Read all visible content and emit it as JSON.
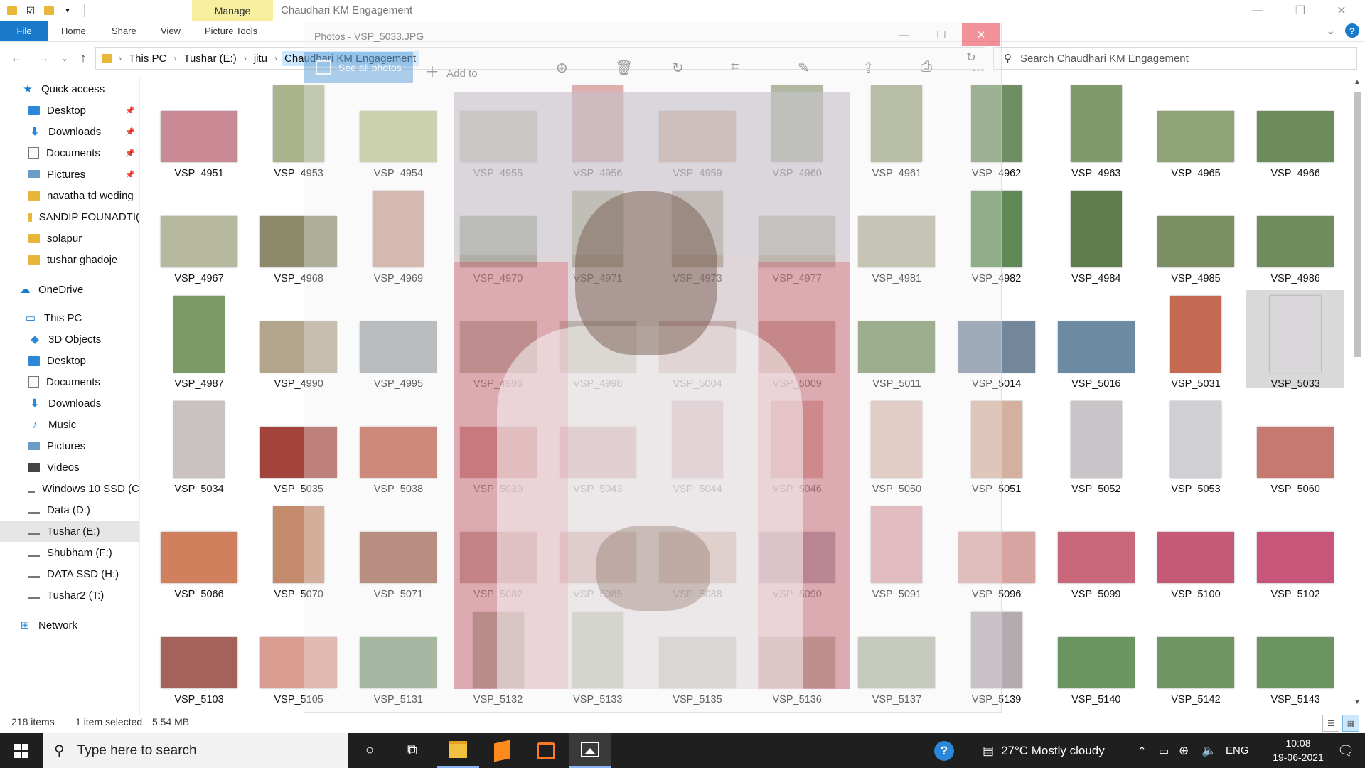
{
  "window": {
    "title": "Chaudhari KM Engagement",
    "manage_label": "Manage",
    "minimize_icon": "—",
    "restore_icon": "❐",
    "close_icon": "✕"
  },
  "ribbon": {
    "tabs": [
      "File",
      "Home",
      "Share",
      "View",
      "Picture Tools"
    ],
    "expand_icon": "⌄",
    "help_icon": "?"
  },
  "address": {
    "breadcrumbs": [
      "This PC",
      "Tushar (E:)",
      "jitu",
      "Chaudhari KM Engagement"
    ],
    "search_placeholder": "Search Chaudhari KM Engagement"
  },
  "nav": {
    "items": [
      {
        "label": "Quick access",
        "icon": "star-icon"
      },
      {
        "label": "Desktop",
        "icon": "desktop-folder-icon",
        "pinned": true
      },
      {
        "label": "Downloads",
        "icon": "downloads-icon",
        "pinned": true
      },
      {
        "label": "Documents",
        "icon": "documents-icon",
        "pinned": true
      },
      {
        "label": "Pictures",
        "icon": "pictures-icon",
        "pinned": true
      },
      {
        "label": "navatha td weding",
        "icon": "folder-icon"
      },
      {
        "label": "SANDIP FOUNADTI(",
        "icon": "folder-icon"
      },
      {
        "label": "solapur",
        "icon": "folder-icon"
      },
      {
        "label": "tushar ghadoje",
        "icon": "folder-icon"
      },
      {
        "label": "OneDrive",
        "icon": "cloud-icon"
      },
      {
        "label": "This PC",
        "icon": "computer-icon"
      },
      {
        "label": "3D Objects",
        "icon": "cube-icon"
      },
      {
        "label": "Desktop",
        "icon": "desktop-folder-icon"
      },
      {
        "label": "Documents",
        "icon": "documents-icon"
      },
      {
        "label": "Downloads",
        "icon": "downloads-icon"
      },
      {
        "label": "Music",
        "icon": "music-icon"
      },
      {
        "label": "Pictures",
        "icon": "pictures-icon"
      },
      {
        "label": "Videos",
        "icon": "videos-icon"
      },
      {
        "label": "Windows 10 SSD (C",
        "icon": "windows-drive-icon"
      },
      {
        "label": "Data (D:)",
        "icon": "drive-icon"
      },
      {
        "label": "Tushar (E:)",
        "icon": "drive-icon",
        "selected": true
      },
      {
        "label": "Shubham (F:)",
        "icon": "drive-icon"
      },
      {
        "label": "DATA SSD (H:)",
        "icon": "drive-icon"
      },
      {
        "label": "Tushar2 (T:)",
        "icon": "drive-icon"
      },
      {
        "label": "Network",
        "icon": "network-icon"
      }
    ]
  },
  "files": [
    {
      "name": "VSP_4951",
      "orient": "l",
      "color": "#c98a96"
    },
    {
      "name": "VSP_4953",
      "orient": "p",
      "color": "#a9b48c"
    },
    {
      "name": "VSP_4954",
      "orient": "l",
      "color": "#b9c08e"
    },
    {
      "name": "VSP_4955",
      "orient": "l",
      "color": "#b5bfa0"
    },
    {
      "name": "VSP_4956",
      "orient": "p",
      "color": "#cf8e8a"
    },
    {
      "name": "VSP_4959",
      "orient": "l",
      "color": "#c99c7e"
    },
    {
      "name": "VSP_4960",
      "orient": "p",
      "color": "#8e9a78"
    },
    {
      "name": "VSP_4961",
      "orient": "p",
      "color": "#9aa47e"
    },
    {
      "name": "VSP_4962",
      "orient": "p",
      "color": "#6f8f63"
    },
    {
      "name": "VSP_4963",
      "orient": "p",
      "color": "#7f9a6c"
    },
    {
      "name": "VSP_4965",
      "orient": "l",
      "color": "#8fa476"
    },
    {
      "name": "VSP_4966",
      "orient": "l",
      "color": "#6d8c5e"
    },
    {
      "name": "VSP_4967",
      "orient": "l",
      "color": "#b7b99e"
    },
    {
      "name": "VSP_4968",
      "orient": "l",
      "color": "#8c8a6a"
    },
    {
      "name": "VSP_4969",
      "orient": "p",
      "color": "#c79a8c"
    },
    {
      "name": "VSP_4970",
      "orient": "l",
      "color": "#7d8f6a"
    },
    {
      "name": "VSP_4971",
      "orient": "p",
      "color": "#8b9866"
    },
    {
      "name": "VSP_4973",
      "orient": "p",
      "color": "#9b8f6d"
    },
    {
      "name": "VSP_4977",
      "orient": "l",
      "color": "#a3a88a"
    },
    {
      "name": "VSP_4981",
      "orient": "l",
      "color": "#b0ac94"
    },
    {
      "name": "VSP_4982",
      "orient": "p",
      "color": "#5f8a55"
    },
    {
      "name": "VSP_4984",
      "orient": "p",
      "color": "#5d7e4c"
    },
    {
      "name": "VSP_4985",
      "orient": "l",
      "color": "#7a9062"
    },
    {
      "name": "VSP_4986",
      "orient": "l",
      "color": "#6f8c5c"
    },
    {
      "name": "VSP_4987",
      "orient": "p",
      "color": "#7c9a66"
    },
    {
      "name": "VSP_4990",
      "orient": "l",
      "color": "#b3a48c"
    },
    {
      "name": "VSP_4995",
      "orient": "l",
      "color": "#9ca1a6"
    },
    {
      "name": "VSP_4996",
      "orient": "l",
      "color": "#8a9374"
    },
    {
      "name": "VSP_4998",
      "orient": "l",
      "color": "#9c9d7c"
    },
    {
      "name": "VSP_5004",
      "orient": "l",
      "color": "#b58a82"
    },
    {
      "name": "VSP_5009",
      "orient": "l",
      "color": "#a37b62"
    },
    {
      "name": "VSP_5011",
      "orient": "l",
      "color": "#6f8a5a"
    },
    {
      "name": "VSP_5014",
      "orient": "l",
      "color": "#74869a"
    },
    {
      "name": "VSP_5016",
      "orient": "l",
      "color": "#6c8ba3"
    },
    {
      "name": "VSP_5031",
      "orient": "p",
      "color": "#c46a52"
    },
    {
      "name": "VSP_5033",
      "orient": "p",
      "color": "#d8d6d8",
      "selected": true
    },
    {
      "name": "VSP_5034",
      "orient": "p",
      "color": "#c9c2c0"
    },
    {
      "name": "VSP_5035",
      "orient": "l",
      "color": "#a3443c"
    },
    {
      "name": "VSP_5038",
      "orient": "l",
      "color": "#b8523e"
    },
    {
      "name": "VSP_5039",
      "orient": "l",
      "color": "#a9473c"
    },
    {
      "name": "VSP_5043",
      "orient": "l",
      "color": "#b9606a"
    },
    {
      "name": "VSP_5044",
      "orient": "p",
      "color": "#c78a86"
    },
    {
      "name": "VSP_5046",
      "orient": "p",
      "color": "#c88070"
    },
    {
      "name": "VSP_5050",
      "orient": "p",
      "color": "#d9b8b0"
    },
    {
      "name": "VSP_5051",
      "orient": "p",
      "color": "#d6b09e"
    },
    {
      "name": "VSP_5052",
      "orient": "p",
      "color": "#c8c4c8"
    },
    {
      "name": "VSP_5053",
      "orient": "p",
      "color": "#d0d0d4"
    },
    {
      "name": "VSP_5060",
      "orient": "l",
      "color": "#c77870"
    },
    {
      "name": "VSP_5066",
      "orient": "l",
      "color": "#d0805c"
    },
    {
      "name": "VSP_5070",
      "orient": "p",
      "color": "#c48a6c"
    },
    {
      "name": "VSP_5071",
      "orient": "l",
      "color": "#9a5a44"
    },
    {
      "name": "VSP_5082",
      "orient": "l",
      "color": "#9a6a58"
    },
    {
      "name": "VSP_5085",
      "orient": "l",
      "color": "#b25a50"
    },
    {
      "name": "VSP_5088",
      "orient": "l",
      "color": "#b06a52"
    },
    {
      "name": "VSP_5090",
      "orient": "l",
      "color": "#7a7486"
    },
    {
      "name": "VSP_5091",
      "orient": "p",
      "color": "#d8a0a8"
    },
    {
      "name": "VSP_5096",
      "orient": "l",
      "color": "#d8a4a2"
    },
    {
      "name": "VSP_5099",
      "orient": "l",
      "color": "#c8687a"
    },
    {
      "name": "VSP_5100",
      "orient": "l",
      "color": "#c45a76"
    },
    {
      "name": "VSP_5102",
      "orient": "l",
      "color": "#c8567a"
    },
    {
      "name": "VSP_5103",
      "orient": "l",
      "color": "#a4625a"
    },
    {
      "name": "VSP_5105",
      "orient": "l",
      "color": "#d89c90"
    },
    {
      "name": "VSP_5131",
      "orient": "l",
      "color": "#7f9a78"
    },
    {
      "name": "VSP_5132",
      "orient": "p",
      "color": "#6f8e5e"
    },
    {
      "name": "VSP_5133",
      "orient": "p",
      "color": "#6d8c5c"
    },
    {
      "name": "VSP_5135",
      "orient": "l",
      "color": "#8c9a78"
    },
    {
      "name": "VSP_5136",
      "orient": "l",
      "color": "#849870"
    },
    {
      "name": "VSP_5137",
      "orient": "l",
      "color": "#b0b6a4"
    },
    {
      "name": "VSP_5139",
      "orient": "p",
      "color": "#b4aab0"
    },
    {
      "name": "VSP_5140",
      "orient": "l",
      "color": "#6a9460"
    },
    {
      "name": "VSP_5142",
      "orient": "l",
      "color": "#6f9662"
    },
    {
      "name": "VSP_5143",
      "orient": "l",
      "color": "#6c9460"
    }
  ],
  "status": {
    "item_count": "218 items",
    "selection": "1 item selected",
    "size": "5.54 MB"
  },
  "photos_app": {
    "title": "Photos - VSP_5033.JPG",
    "see_all": "See all photos",
    "add_to": "Add to",
    "tools": [
      {
        "icon": "zoom-in-icon",
        "glyph": "⊕"
      },
      {
        "icon": "delete-icon",
        "glyph": "🗑"
      },
      {
        "icon": "rotate-icon",
        "glyph": "↻"
      },
      {
        "icon": "crop-icon",
        "glyph": "⌗"
      },
      {
        "icon": "edit-icon",
        "glyph": "✎"
      },
      {
        "icon": "share-icon",
        "glyph": "⇪"
      },
      {
        "icon": "print-icon",
        "glyph": "⎙"
      },
      {
        "icon": "more-icon",
        "glyph": "…"
      }
    ]
  },
  "taskbar": {
    "search_placeholder": "Type here to search",
    "weather": "27°C  Mostly cloudy",
    "language": "ENG",
    "time": "10:08",
    "date": "19-06-2021"
  }
}
